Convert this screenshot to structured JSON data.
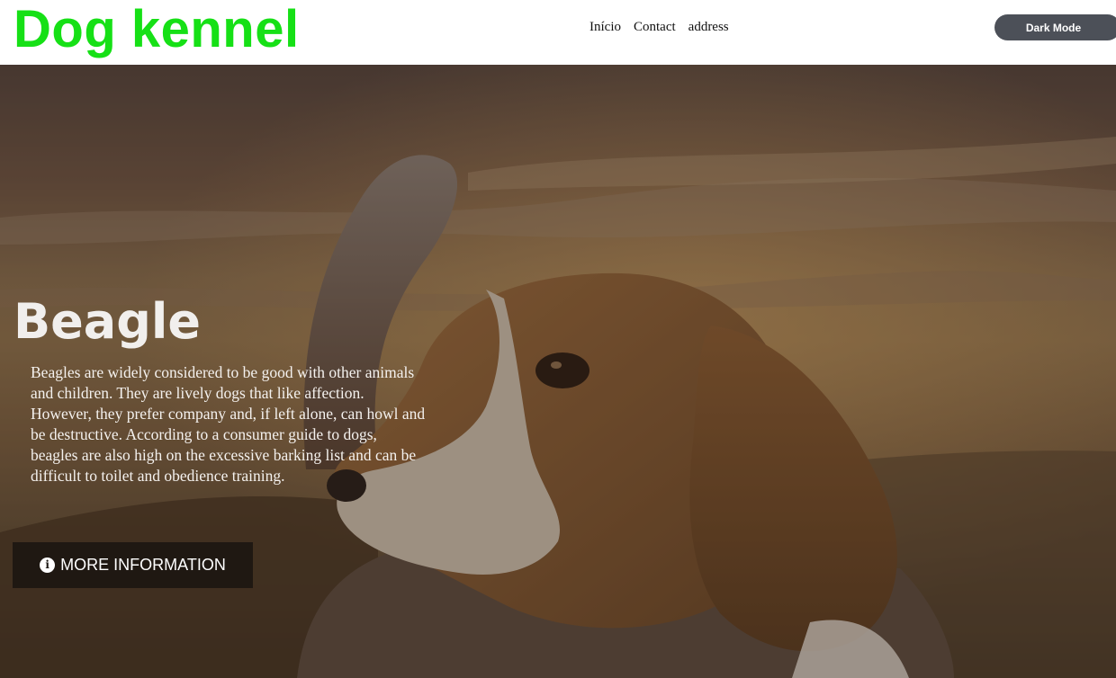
{
  "header": {
    "brand": "Dog kennel",
    "nav": [
      {
        "label": "Início"
      },
      {
        "label": "Contact"
      },
      {
        "label": "address"
      }
    ],
    "dark_mode_label": "Dark Mode"
  },
  "hero": {
    "title": "Beagle",
    "description": "Beagles are widely considered to be good with other animals and children. They are lively dogs that like affection. However, they prefer company and, if left alone, can howl and be destructive. According to a consumer guide to dogs, beagles are also high on the excessive barking list and can be difficult to toilet and obedience training.",
    "button_label": "MORE INFORMATION",
    "button_icon": "info-icon",
    "background_subject": "beagle-photo"
  },
  "colors": {
    "brand": "#16e016",
    "dark_button": "#4c5058",
    "hero_overlay": "#1a1612"
  }
}
